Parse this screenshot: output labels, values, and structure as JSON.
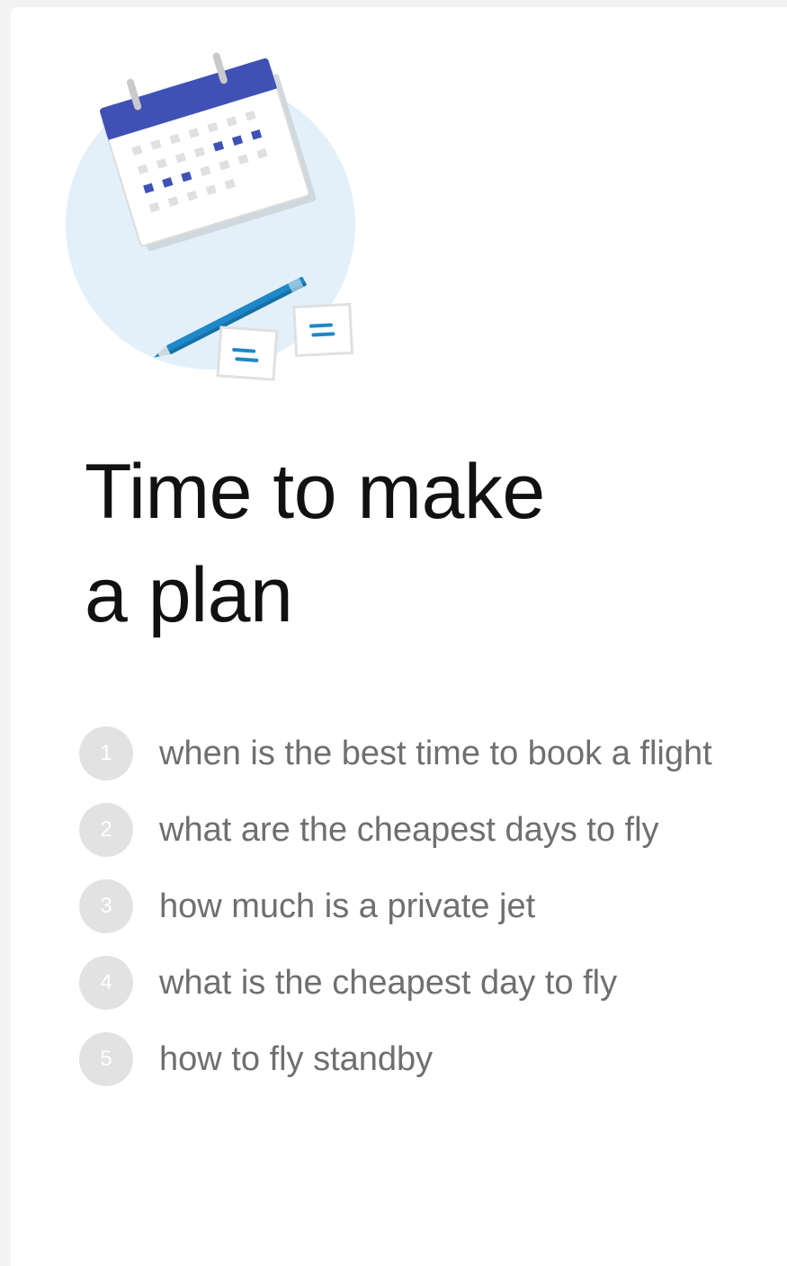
{
  "header": {
    "title_line1": "Time to make",
    "title_line2": "a plan"
  },
  "illustration": {
    "icon": "calendar-pencil-notes-illustration",
    "colors": {
      "circle": "#e3f0fa",
      "calendar_header": "#3f51b5",
      "calendar_dot": "#3f51b5",
      "pencil": "#1e88c8"
    }
  },
  "list": {
    "items": [
      {
        "number": "1",
        "label": "when is the best time to book a flight"
      },
      {
        "number": "2",
        "label": "what are the cheapest days to fly"
      },
      {
        "number": "3",
        "label": "how much is a private jet"
      },
      {
        "number": "4",
        "label": "what is the cheapest day to fly"
      },
      {
        "number": "5",
        "label": "how to fly standby"
      }
    ]
  },
  "colors": {
    "badge_bg": "#e2e2e2",
    "label_text": "#6f6f6f",
    "title_text": "#111111"
  }
}
